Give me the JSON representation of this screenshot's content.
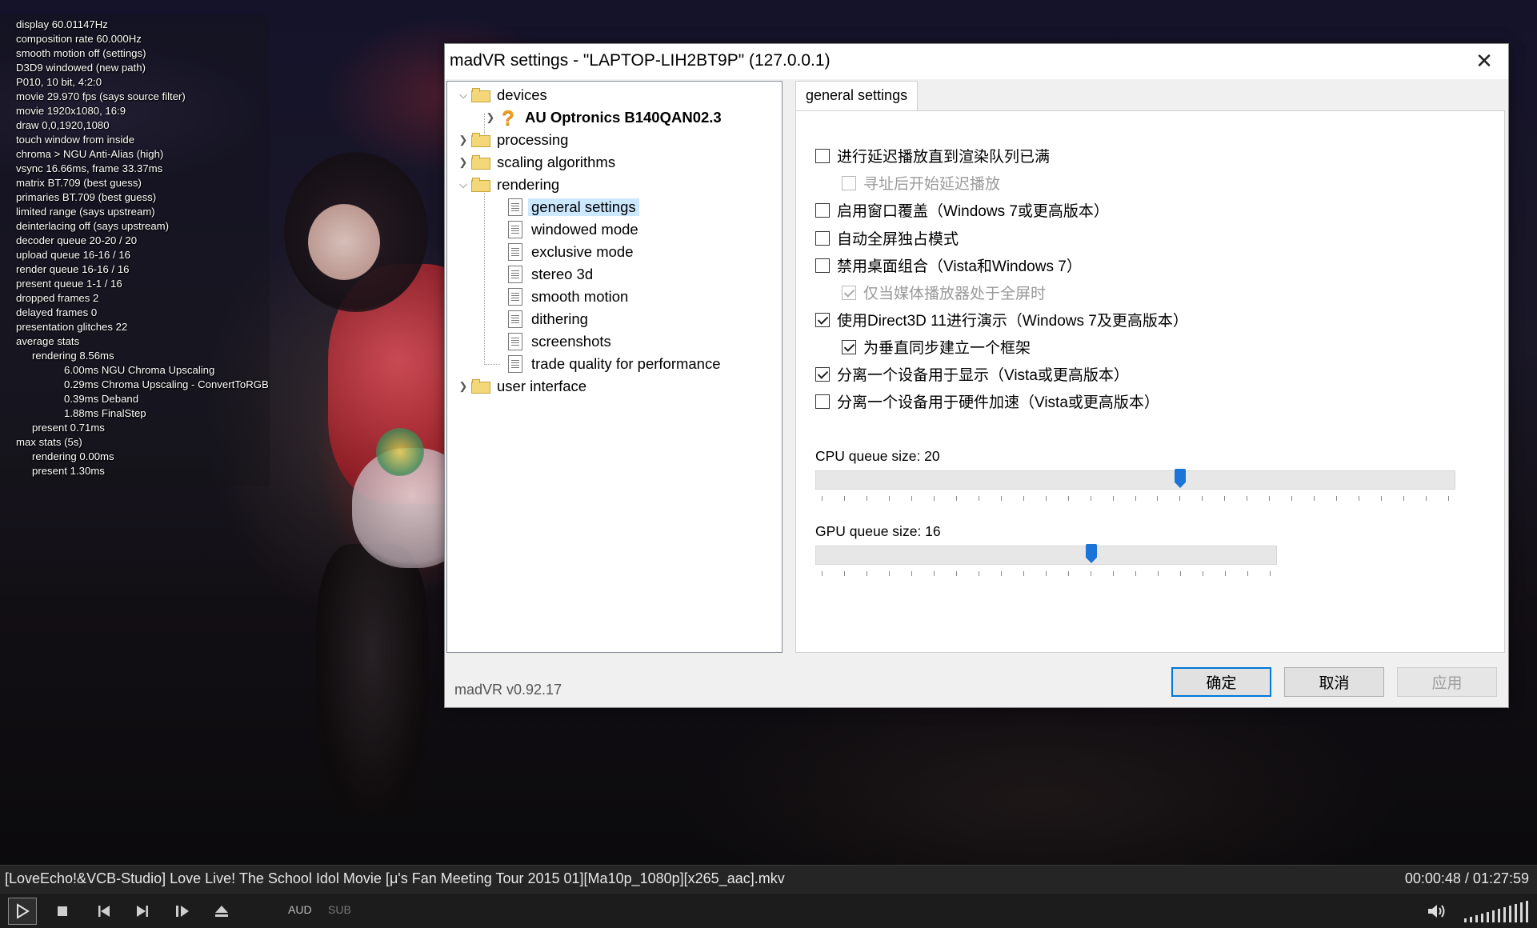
{
  "osd": {
    "lines": [
      "display 60.01147Hz",
      "composition rate 60.000Hz",
      "smooth motion off (settings)",
      "D3D9 windowed (new path)",
      "P010, 10 bit, 4:2:0",
      "movie 29.970 fps  (says source filter)",
      "movie 1920x1080, 16:9",
      "draw 0,0,1920,1080",
      "touch window from inside",
      "chroma > NGU Anti-Alias (high)",
      "vsync 16.66ms, frame 33.37ms",
      "matrix BT.709 (best guess)",
      "primaries BT.709 (best guess)",
      "limited range (says upstream)",
      "deinterlacing off (says upstream)",
      "decoder queue 20-20 / 20",
      "upload queue 16-16 / 16",
      "render queue 16-16 / 16",
      "present queue 1-1 / 16",
      "dropped frames 2",
      "delayed frames 0",
      "presentation glitches 22",
      "average stats",
      "rendering 8.56ms",
      "6.00ms NGU Chroma Upscaling",
      "0.29ms Chroma Upscaling - ConvertToRGB",
      "0.39ms Deband",
      "1.88ms FinalStep",
      "present 0.71ms",
      "max stats (5s)",
      "rendering 0.00ms",
      "present 1.30ms"
    ]
  },
  "dialog": {
    "title": "madVR settings - \"LAPTOP-LIH2BT9P\" (127.0.0.1)",
    "close_glyph": "✕",
    "version": "madVR v0.92.17",
    "tree": {
      "devices": "devices",
      "device_name": "AU Optronics B140QAN02.3",
      "processing": "processing",
      "scaling": "scaling algorithms",
      "rendering": "rendering",
      "general": "general settings",
      "windowed": "windowed mode",
      "exclusive": "exclusive mode",
      "stereo": "stereo 3d",
      "smooth": "smooth motion",
      "dithering": "dithering",
      "screenshots": "screenshots",
      "trade": "trade quality for performance",
      "ui": "user interface"
    },
    "tab_label": "general settings",
    "options": [
      {
        "label": "进行延迟播放直到渲染队列已满",
        "checked": false,
        "disabled": false
      },
      {
        "label": "寻址后开始延迟播放",
        "checked": false,
        "disabled": true
      },
      {
        "label": "启用窗口覆盖（Windows 7或更高版本）",
        "checked": false,
        "disabled": false
      },
      {
        "label": "自动全屏独占模式",
        "checked": false,
        "disabled": false
      },
      {
        "label": "禁用桌面组合（Vista和Windows 7）",
        "checked": false,
        "disabled": false
      },
      {
        "label": "仅当媒体播放器处于全屏时",
        "checked": true,
        "disabled": true
      },
      {
        "label": "使用Direct3D 11进行演示（Windows 7及更高版本）",
        "checked": true,
        "disabled": false
      },
      {
        "label": "为垂直同步建立一个框架",
        "checked": true,
        "disabled": false
      },
      {
        "label": "分离一个设备用于显示（Vista或更高版本）",
        "checked": true,
        "disabled": false
      },
      {
        "label": "分离一个设备用于硬件加速（Vista或更高版本）",
        "checked": false,
        "disabled": false
      }
    ],
    "cpu_queue": {
      "label": "CPU queue size: 20",
      "value": 20,
      "min": 4,
      "max": 32
    },
    "gpu_queue": {
      "label": "GPU queue size: 16",
      "value": 16,
      "min": 4,
      "max": 24
    },
    "buttons": {
      "ok": "确定",
      "cancel": "取消",
      "apply": "应用"
    }
  },
  "player": {
    "filename": "[LoveEcho!&VCB-Studio] Love Live! The School Idol Movie [μ's Fan Meeting Tour 2015 01][Ma10p_1080p][x265_aac].mkv",
    "time": "00:00:48 / 01:27:59",
    "audio_label": "AUD",
    "sub_label": "SUB",
    "volume_level": 1.0
  }
}
